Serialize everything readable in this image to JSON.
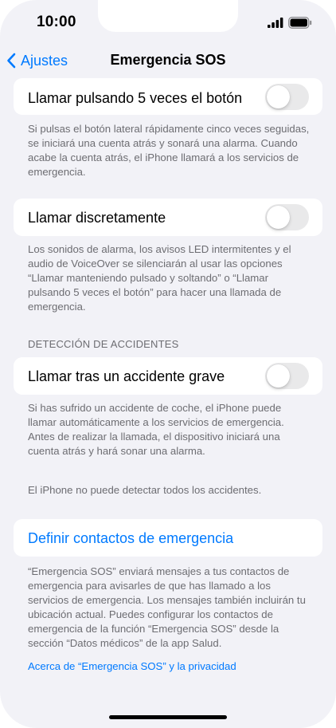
{
  "status_bar": {
    "time": "10:00"
  },
  "nav": {
    "back_label": "Ajustes",
    "title": "Emergencia SOS"
  },
  "rows": {
    "call_5_presses": {
      "label": "Llamar pulsando 5 veces el botón",
      "enabled": false
    },
    "call_quietly": {
      "label": "Llamar discretamente",
      "enabled": false
    },
    "call_after_crash": {
      "label": "Llamar tras un accidente grave",
      "enabled": false
    },
    "emergency_contacts": {
      "label": "Definir contactos de emergencia"
    }
  },
  "footnotes": {
    "call_5_presses": "Si pulsas el botón lateral rápidamente cinco veces seguidas, se iniciará una cuenta atrás y sonará una alarma. Cuando acabe la cuenta atrás, el iPhone llamará a los servicios de emergencia.",
    "call_quietly": "Los sonidos de alarma, los avisos LED intermitentes y el audio de VoiceOver se silenciarán al usar las opciones “Llamar manteniendo pulsado y soltando” o “Llamar pulsando 5 veces el botón” para hacer una llamada de emergencia.",
    "crash_1": "Si has sufrido un accidente de coche, el iPhone puede llamar automáticamente a los servicios de emergencia. Antes de realizar la llamada, el dispositivo iniciará una cuenta atrás y hará sonar una alarma.",
    "crash_2": "El iPhone no puede detectar todos los accidentes.",
    "contacts": "“Emergencia SOS” enviará mensajes a tus contactos de emergencia para avisarles de que has llamado a los servicios de emergencia. Los mensajes también incluirán tu ubicación actual. Puedes configurar los contactos de emergencia de la función “Emergencia SOS” desde la sección “Datos médicos” de la app Salud."
  },
  "section_headers": {
    "crash_detection": "DETECCIÓN DE ACCIDENTES"
  },
  "links": {
    "privacy": "Acerca de “Emergencia SOS” y la privacidad"
  },
  "colors": {
    "accent": "#007aff",
    "background": "#f2f2f7",
    "toggle_off": "#e9e9ea",
    "secondary_text": "#6d6d72"
  }
}
